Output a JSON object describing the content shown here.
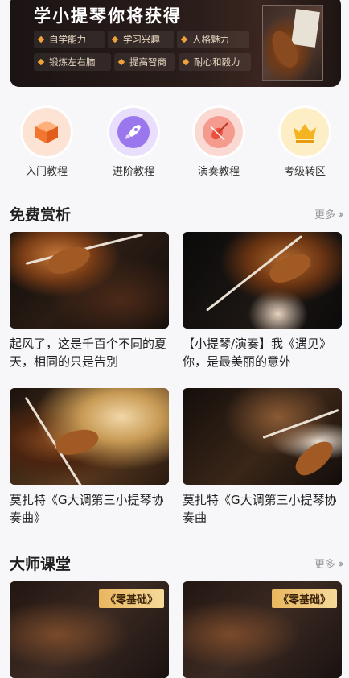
{
  "banner": {
    "title": "学小提琴你将获得",
    "benefits": [
      "自学能力",
      "学习兴趣",
      "人格魅力",
      "锻炼左右脑",
      "提高智商",
      "耐心和毅力"
    ]
  },
  "categories": [
    {
      "label": "入门教程",
      "icon": "cube-icon",
      "color": "#f2762f",
      "bg": "#fde3d3"
    },
    {
      "label": "进阶教程",
      "icon": "rocket-icon",
      "color": "#8a63e6",
      "bg": "#e9defb"
    },
    {
      "label": "演奏教程",
      "icon": "violin-icon",
      "color": "#f06b5e",
      "bg": "#fbd9d3"
    },
    {
      "label": "考级转区",
      "icon": "crown-icon",
      "color": "#f4b321",
      "bg": "#fdeec6"
    }
  ],
  "free": {
    "title": "免费赏析",
    "more": "更多",
    "cards": [
      {
        "title": "起风了，这是千百个不同的夏天，相同的只是告别"
      },
      {
        "title": "【小提琴/演奏】我《遇见》你，是最美丽的意外"
      },
      {
        "title": "莫扎特《G大调第三小提琴协奏曲》"
      },
      {
        "title": "莫扎特《G大调第三小提琴协奏曲"
      }
    ]
  },
  "master": {
    "title": "大师课堂",
    "more": "更多",
    "cards": [
      {
        "tag": "《零基础》"
      },
      {
        "tag": "《零基础》"
      }
    ]
  }
}
